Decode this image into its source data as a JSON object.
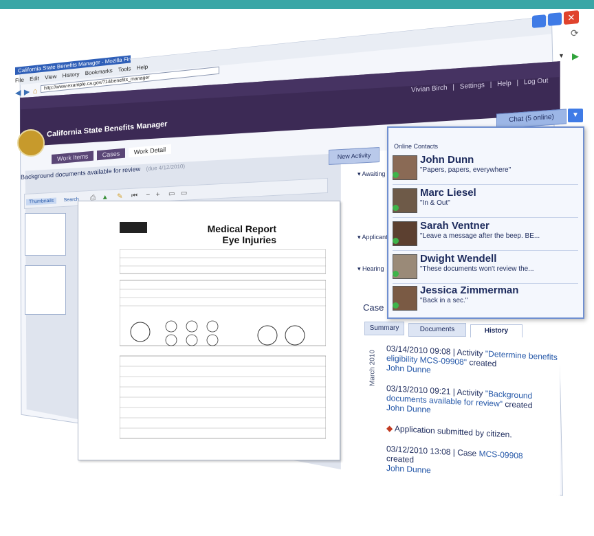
{
  "browser": {
    "window_title": "California State Benefits Manager - Mozilla Firefox",
    "menu": [
      "File",
      "Edit",
      "View",
      "History",
      "Bookmarks",
      "Tools",
      "Help"
    ],
    "address": "http://www.example.ca.gov/?1&benefits_manager"
  },
  "header": {
    "app_title": "California State Benefits Manager",
    "user_name": "Vivian Birch",
    "settings_label": "Settings",
    "help_label": "Help",
    "logout_label": "Log Out",
    "chat_label": "Chat (5 online)",
    "tabs": [
      "Work Items",
      "Cases",
      "Work Detail"
    ]
  },
  "document": {
    "title_prefix": "Background documents available for review",
    "title_suffix": "(due 4/12/2010)",
    "toolbar_left": [
      "Thumbnails",
      "Search"
    ],
    "report_title_1": "Medical Report",
    "report_title_2": "Eye Injuries"
  },
  "right": {
    "new_activity_label": "New Activity",
    "section_labels": [
      "Awaiting",
      "Applicants",
      "Hearing"
    ],
    "case_label": "Case",
    "case_tabs": [
      "Summary",
      "Documents",
      "History"
    ],
    "month_label": "March 2010"
  },
  "history": [
    {
      "datetime": "03/14/2010 09:08",
      "kind": "Activity",
      "link": "\"Determine benefits eligibility MCS-09908\"",
      "action": "created",
      "person": "John Dunne"
    },
    {
      "datetime": "03/13/2010 09:21",
      "kind": "Activity",
      "link": "\"Background documents available for review\"",
      "action": "created",
      "person": "John Dunne"
    },
    {
      "note": "Application submitted by citizen."
    },
    {
      "datetime": "03/12/2010 13:08",
      "kind": "Case",
      "link": "MCS-09908",
      "action": "created",
      "person": "John Dunne"
    }
  ],
  "chat": {
    "heading": "Online Contacts",
    "contacts": [
      {
        "name": "John Dunn",
        "status": "\"Papers, papers, everywhere\""
      },
      {
        "name": "Marc Liesel",
        "status": "\"In & Out\""
      },
      {
        "name": "Sarah Ventner",
        "status": "\"Leave a message after the beep. BE..."
      },
      {
        "name": "Dwight Wendell",
        "status": "\"These documents won't review the..."
      },
      {
        "name": "Jessica Zimmerman",
        "status": "\"Back in a sec.\""
      }
    ]
  },
  "colors": {
    "header_purple": "#3c2a55",
    "accent_teal": "#3aa6a6",
    "chat_border": "#6f8fd0",
    "link_blue": "#2457a8",
    "alert_red": "#c23b22"
  }
}
